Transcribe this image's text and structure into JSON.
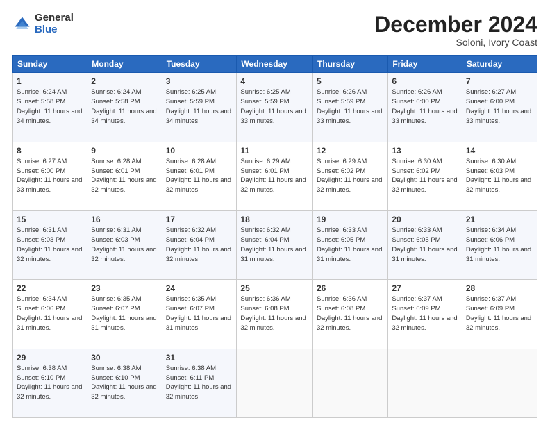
{
  "logo": {
    "general": "General",
    "blue": "Blue"
  },
  "header": {
    "title": "December 2024",
    "subtitle": "Soloni, Ivory Coast"
  },
  "days_of_week": [
    "Sunday",
    "Monday",
    "Tuesday",
    "Wednesday",
    "Thursday",
    "Friday",
    "Saturday"
  ],
  "weeks": [
    [
      {
        "day": "1",
        "sunrise": "Sunrise: 6:24 AM",
        "sunset": "Sunset: 5:58 PM",
        "daylight": "Daylight: 11 hours and 34 minutes."
      },
      {
        "day": "2",
        "sunrise": "Sunrise: 6:24 AM",
        "sunset": "Sunset: 5:58 PM",
        "daylight": "Daylight: 11 hours and 34 minutes."
      },
      {
        "day": "3",
        "sunrise": "Sunrise: 6:25 AM",
        "sunset": "Sunset: 5:59 PM",
        "daylight": "Daylight: 11 hours and 34 minutes."
      },
      {
        "day": "4",
        "sunrise": "Sunrise: 6:25 AM",
        "sunset": "Sunset: 5:59 PM",
        "daylight": "Daylight: 11 hours and 33 minutes."
      },
      {
        "day": "5",
        "sunrise": "Sunrise: 6:26 AM",
        "sunset": "Sunset: 5:59 PM",
        "daylight": "Daylight: 11 hours and 33 minutes."
      },
      {
        "day": "6",
        "sunrise": "Sunrise: 6:26 AM",
        "sunset": "Sunset: 6:00 PM",
        "daylight": "Daylight: 11 hours and 33 minutes."
      },
      {
        "day": "7",
        "sunrise": "Sunrise: 6:27 AM",
        "sunset": "Sunset: 6:00 PM",
        "daylight": "Daylight: 11 hours and 33 minutes."
      }
    ],
    [
      {
        "day": "8",
        "sunrise": "Sunrise: 6:27 AM",
        "sunset": "Sunset: 6:00 PM",
        "daylight": "Daylight: 11 hours and 33 minutes."
      },
      {
        "day": "9",
        "sunrise": "Sunrise: 6:28 AM",
        "sunset": "Sunset: 6:01 PM",
        "daylight": "Daylight: 11 hours and 32 minutes."
      },
      {
        "day": "10",
        "sunrise": "Sunrise: 6:28 AM",
        "sunset": "Sunset: 6:01 PM",
        "daylight": "Daylight: 11 hours and 32 minutes."
      },
      {
        "day": "11",
        "sunrise": "Sunrise: 6:29 AM",
        "sunset": "Sunset: 6:01 PM",
        "daylight": "Daylight: 11 hours and 32 minutes."
      },
      {
        "day": "12",
        "sunrise": "Sunrise: 6:29 AM",
        "sunset": "Sunset: 6:02 PM",
        "daylight": "Daylight: 11 hours and 32 minutes."
      },
      {
        "day": "13",
        "sunrise": "Sunrise: 6:30 AM",
        "sunset": "Sunset: 6:02 PM",
        "daylight": "Daylight: 11 hours and 32 minutes."
      },
      {
        "day": "14",
        "sunrise": "Sunrise: 6:30 AM",
        "sunset": "Sunset: 6:03 PM",
        "daylight": "Daylight: 11 hours and 32 minutes."
      }
    ],
    [
      {
        "day": "15",
        "sunrise": "Sunrise: 6:31 AM",
        "sunset": "Sunset: 6:03 PM",
        "daylight": "Daylight: 11 hours and 32 minutes."
      },
      {
        "day": "16",
        "sunrise": "Sunrise: 6:31 AM",
        "sunset": "Sunset: 6:03 PM",
        "daylight": "Daylight: 11 hours and 32 minutes."
      },
      {
        "day": "17",
        "sunrise": "Sunrise: 6:32 AM",
        "sunset": "Sunset: 6:04 PM",
        "daylight": "Daylight: 11 hours and 32 minutes."
      },
      {
        "day": "18",
        "sunrise": "Sunrise: 6:32 AM",
        "sunset": "Sunset: 6:04 PM",
        "daylight": "Daylight: 11 hours and 31 minutes."
      },
      {
        "day": "19",
        "sunrise": "Sunrise: 6:33 AM",
        "sunset": "Sunset: 6:05 PM",
        "daylight": "Daylight: 11 hours and 31 minutes."
      },
      {
        "day": "20",
        "sunrise": "Sunrise: 6:33 AM",
        "sunset": "Sunset: 6:05 PM",
        "daylight": "Daylight: 11 hours and 31 minutes."
      },
      {
        "day": "21",
        "sunrise": "Sunrise: 6:34 AM",
        "sunset": "Sunset: 6:06 PM",
        "daylight": "Daylight: 11 hours and 31 minutes."
      }
    ],
    [
      {
        "day": "22",
        "sunrise": "Sunrise: 6:34 AM",
        "sunset": "Sunset: 6:06 PM",
        "daylight": "Daylight: 11 hours and 31 minutes."
      },
      {
        "day": "23",
        "sunrise": "Sunrise: 6:35 AM",
        "sunset": "Sunset: 6:07 PM",
        "daylight": "Daylight: 11 hours and 31 minutes."
      },
      {
        "day": "24",
        "sunrise": "Sunrise: 6:35 AM",
        "sunset": "Sunset: 6:07 PM",
        "daylight": "Daylight: 11 hours and 31 minutes."
      },
      {
        "day": "25",
        "sunrise": "Sunrise: 6:36 AM",
        "sunset": "Sunset: 6:08 PM",
        "daylight": "Daylight: 11 hours and 32 minutes."
      },
      {
        "day": "26",
        "sunrise": "Sunrise: 6:36 AM",
        "sunset": "Sunset: 6:08 PM",
        "daylight": "Daylight: 11 hours and 32 minutes."
      },
      {
        "day": "27",
        "sunrise": "Sunrise: 6:37 AM",
        "sunset": "Sunset: 6:09 PM",
        "daylight": "Daylight: 11 hours and 32 minutes."
      },
      {
        "day": "28",
        "sunrise": "Sunrise: 6:37 AM",
        "sunset": "Sunset: 6:09 PM",
        "daylight": "Daylight: 11 hours and 32 minutes."
      }
    ],
    [
      {
        "day": "29",
        "sunrise": "Sunrise: 6:38 AM",
        "sunset": "Sunset: 6:10 PM",
        "daylight": "Daylight: 11 hours and 32 minutes."
      },
      {
        "day": "30",
        "sunrise": "Sunrise: 6:38 AM",
        "sunset": "Sunset: 6:10 PM",
        "daylight": "Daylight: 11 hours and 32 minutes."
      },
      {
        "day": "31",
        "sunrise": "Sunrise: 6:38 AM",
        "sunset": "Sunset: 6:11 PM",
        "daylight": "Daylight: 11 hours and 32 minutes."
      },
      null,
      null,
      null,
      null
    ]
  ]
}
